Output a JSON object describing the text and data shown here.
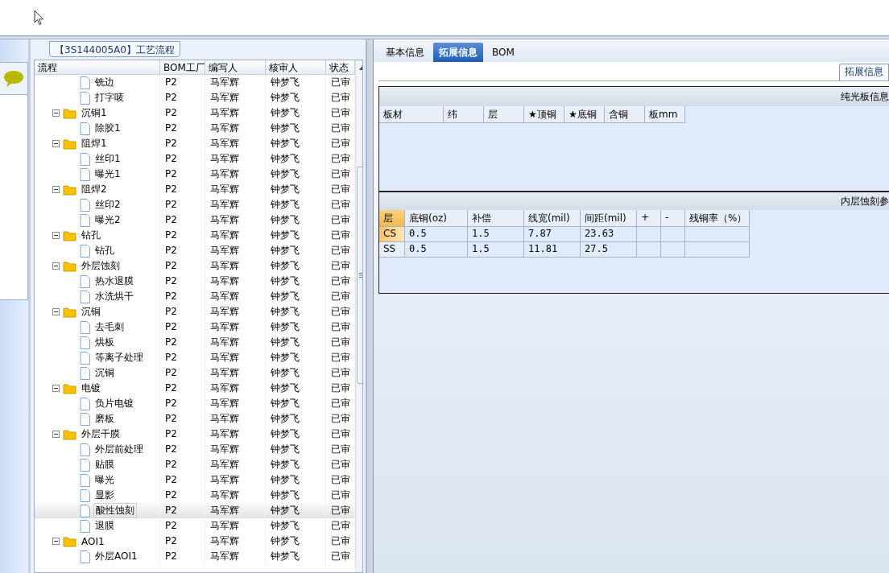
{
  "panel_title": "【3S144005A0】工艺流程",
  "tree_columns": [
    "流程",
    "BOM工厂",
    "编写人",
    "核审人",
    "状态"
  ],
  "tree": [
    {
      "kind": "folder-continued",
      "children": [
        {
          "kind": "file",
          "label": "铣边",
          "factory": "P2",
          "writer": "马军辉",
          "reviewer": "钟梦飞",
          "status": "已审",
          "selected": false
        },
        {
          "kind": "file",
          "label": "打字唛",
          "factory": "P2",
          "writer": "马军辉",
          "reviewer": "钟梦飞",
          "status": "已审",
          "selected": false
        }
      ]
    },
    {
      "kind": "folder",
      "label": "沉铜1",
      "expanded": true,
      "factory": "P2",
      "writer": "马军辉",
      "reviewer": "钟梦飞",
      "status": "已审",
      "selected": false,
      "children": [
        {
          "kind": "file",
          "label": "除胶1",
          "factory": "P2",
          "writer": "马军辉",
          "reviewer": "钟梦飞",
          "status": "已审",
          "selected": false
        }
      ]
    },
    {
      "kind": "folder",
      "label": "阻焊1",
      "expanded": true,
      "factory": "P2",
      "writer": "马军辉",
      "reviewer": "钟梦飞",
      "status": "已审",
      "selected": false,
      "children": [
        {
          "kind": "file",
          "label": "丝印1",
          "factory": "P2",
          "writer": "马军辉",
          "reviewer": "钟梦飞",
          "status": "已审",
          "selected": false
        },
        {
          "kind": "file",
          "label": "曝光1",
          "factory": "P2",
          "writer": "马军辉",
          "reviewer": "钟梦飞",
          "status": "已审",
          "selected": false
        }
      ]
    },
    {
      "kind": "folder",
      "label": "阻焊2",
      "expanded": true,
      "factory": "P2",
      "writer": "马军辉",
      "reviewer": "钟梦飞",
      "status": "已审",
      "selected": false,
      "children": [
        {
          "kind": "file",
          "label": "丝印2",
          "factory": "P2",
          "writer": "马军辉",
          "reviewer": "钟梦飞",
          "status": "已审",
          "selected": false
        },
        {
          "kind": "file",
          "label": "曝光2",
          "factory": "P2",
          "writer": "马军辉",
          "reviewer": "钟梦飞",
          "status": "已审",
          "selected": false
        }
      ]
    },
    {
      "kind": "folder",
      "label": "钻孔",
      "expanded": true,
      "factory": "P2",
      "writer": "马军辉",
      "reviewer": "钟梦飞",
      "status": "已审",
      "selected": false,
      "children": [
        {
          "kind": "file",
          "label": "钻孔",
          "factory": "P2",
          "writer": "马军辉",
          "reviewer": "钟梦飞",
          "status": "已审",
          "selected": false
        }
      ]
    },
    {
      "kind": "folder",
      "label": "外层蚀刻",
      "expanded": true,
      "factory": "P2",
      "writer": "马军辉",
      "reviewer": "钟梦飞",
      "status": "已审",
      "selected": false,
      "children": [
        {
          "kind": "file",
          "label": "热水退膜",
          "factory": "P2",
          "writer": "马军辉",
          "reviewer": "钟梦飞",
          "status": "已审",
          "selected": false
        },
        {
          "kind": "file",
          "label": "水洗烘干",
          "factory": "P2",
          "writer": "马军辉",
          "reviewer": "钟梦飞",
          "status": "已审",
          "selected": false
        }
      ]
    },
    {
      "kind": "folder",
      "label": "沉铜",
      "expanded": true,
      "factory": "P2",
      "writer": "马军辉",
      "reviewer": "钟梦飞",
      "status": "已审",
      "selected": false,
      "children": [
        {
          "kind": "file",
          "label": "去毛刺",
          "factory": "P2",
          "writer": "马军辉",
          "reviewer": "钟梦飞",
          "status": "已审",
          "selected": false
        },
        {
          "kind": "file",
          "label": "烘板",
          "factory": "P2",
          "writer": "马军辉",
          "reviewer": "钟梦飞",
          "status": "已审",
          "selected": false
        },
        {
          "kind": "file",
          "label": "等离子处理",
          "factory": "P2",
          "writer": "马军辉",
          "reviewer": "钟梦飞",
          "status": "已审",
          "selected": false
        },
        {
          "kind": "file",
          "label": "沉铜",
          "factory": "P2",
          "writer": "马军辉",
          "reviewer": "钟梦飞",
          "status": "已审",
          "selected": false
        }
      ]
    },
    {
      "kind": "folder",
      "label": "电镀",
      "expanded": true,
      "factory": "P2",
      "writer": "马军辉",
      "reviewer": "钟梦飞",
      "status": "已审",
      "selected": false,
      "children": [
        {
          "kind": "file",
          "label": "负片电镀",
          "factory": "P2",
          "writer": "马军辉",
          "reviewer": "钟梦飞",
          "status": "已审",
          "selected": false
        },
        {
          "kind": "file",
          "label": "磨板",
          "factory": "P2",
          "writer": "马军辉",
          "reviewer": "钟梦飞",
          "status": "已审",
          "selected": false
        }
      ]
    },
    {
      "kind": "folder",
      "label": "外层干膜",
      "expanded": true,
      "factory": "P2",
      "writer": "马军辉",
      "reviewer": "钟梦飞",
      "status": "已审",
      "selected": false,
      "children": [
        {
          "kind": "file",
          "label": "外层前处理",
          "factory": "P2",
          "writer": "马军辉",
          "reviewer": "钟梦飞",
          "status": "已审",
          "selected": false
        },
        {
          "kind": "file",
          "label": "贴膜",
          "factory": "P2",
          "writer": "马军辉",
          "reviewer": "钟梦飞",
          "status": "已审",
          "selected": false
        },
        {
          "kind": "file",
          "label": "曝光",
          "factory": "P2",
          "writer": "马军辉",
          "reviewer": "钟梦飞",
          "status": "已审",
          "selected": false
        },
        {
          "kind": "file",
          "label": "显影",
          "factory": "P2",
          "writer": "马军辉",
          "reviewer": "钟梦飞",
          "status": "已审",
          "selected": false
        },
        {
          "kind": "file",
          "label": "酸性蚀刻",
          "factory": "P2",
          "writer": "马军辉",
          "reviewer": "钟梦飞",
          "status": "已审",
          "selected": true
        },
        {
          "kind": "file",
          "label": "退膜",
          "factory": "P2",
          "writer": "马军辉",
          "reviewer": "钟梦飞",
          "status": "已审",
          "selected": false
        }
      ]
    },
    {
      "kind": "folder",
      "label": "AOI1",
      "expanded": true,
      "factory": "P2",
      "writer": "马军辉",
      "reviewer": "钟梦飞",
      "status": "已审",
      "selected": false,
      "children": [
        {
          "kind": "file",
          "label": "外层AOI1",
          "factory": "P2",
          "writer": "马军辉",
          "reviewer": "钟梦飞",
          "status": "已审",
          "selected": false
        }
      ]
    }
  ],
  "tabs": [
    {
      "label": "基本信息",
      "selected": false
    },
    {
      "label": "拓展信息",
      "selected": true
    },
    {
      "label": "BOM",
      "selected": false
    }
  ],
  "section_caption": "拓展信息",
  "plain_board": {
    "title": "纯光板信息",
    "columns": [
      "板材",
      "纬",
      "层",
      "★顶铜",
      "★底铜",
      "含铜",
      "板mm"
    ]
  },
  "inner_etching": {
    "title": "内层蚀刻参",
    "columns": [
      "层",
      "底铜(oz)",
      "补偿",
      "线宽(mil)",
      "间距(mil)",
      "+",
      "-",
      "残铜率（%）"
    ],
    "rows": [
      {
        "selected": true,
        "cells": [
          "CS",
          "0.5",
          "1.5",
          "7.87",
          "23.63"
        ]
      },
      {
        "selected": false,
        "cells": [
          "SS",
          "0.5",
          "1.5",
          "11.81",
          "27.5"
        ]
      }
    ]
  }
}
